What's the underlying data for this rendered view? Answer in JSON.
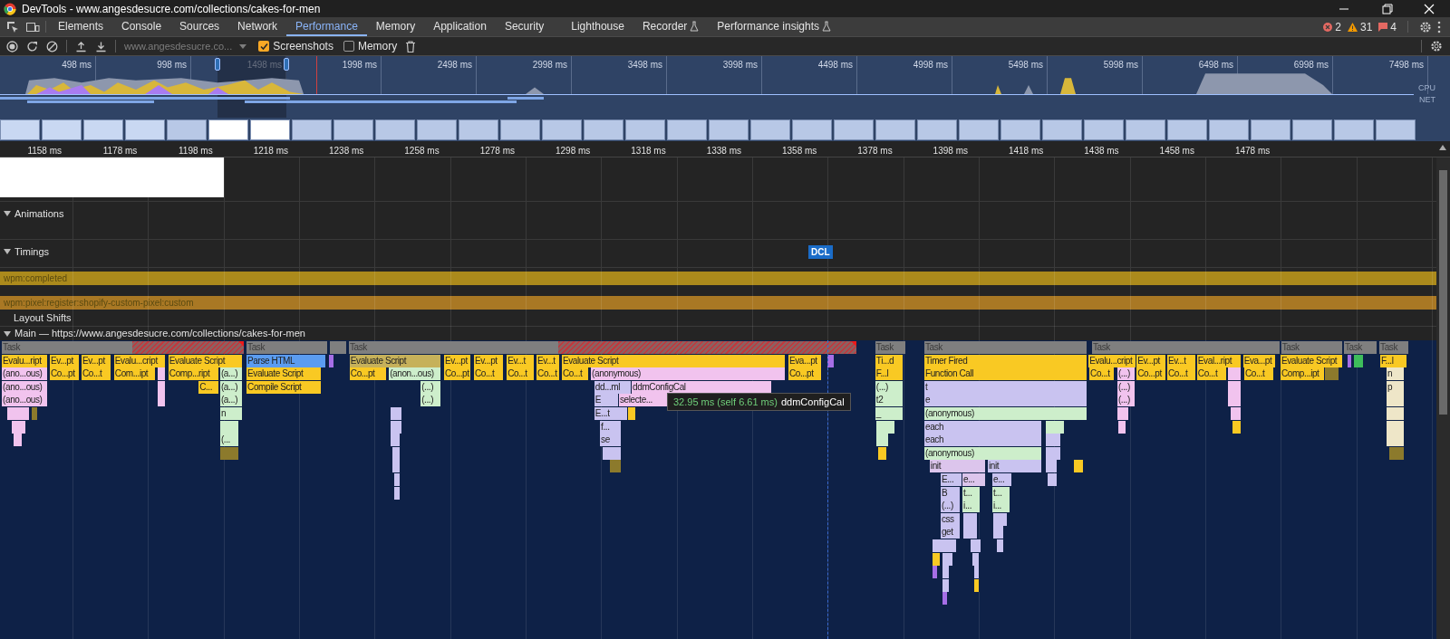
{
  "window": {
    "title": "DevTools - www.angesdesucre.com/collections/cakes-for-men"
  },
  "tabs": [
    {
      "label": "Elements",
      "selected": false,
      "experimental": false
    },
    {
      "label": "Console",
      "selected": false,
      "experimental": false
    },
    {
      "label": "Sources",
      "selected": false,
      "experimental": false
    },
    {
      "label": "Network",
      "selected": false,
      "experimental": false
    },
    {
      "label": "Performance",
      "selected": true,
      "experimental": false
    },
    {
      "label": "Memory",
      "selected": false,
      "experimental": false
    },
    {
      "label": "Application",
      "selected": false,
      "experimental": false
    },
    {
      "label": "Security",
      "selected": false,
      "experimental": false
    },
    {
      "label": "Lighthouse",
      "selected": false,
      "experimental": false
    },
    {
      "label": "Recorder",
      "selected": false,
      "experimental": true
    },
    {
      "label": "Performance insights",
      "selected": false,
      "experimental": true
    }
  ],
  "issues": {
    "errors": "2",
    "warnings": "31",
    "messages": "4"
  },
  "toolbar": {
    "recording_select": "www.angesdesucre.co...",
    "options": [
      {
        "label": "Screenshots",
        "checked": true
      },
      {
        "label": "Memory",
        "checked": false
      }
    ]
  },
  "overview": {
    "time_labels": [
      "498 ms",
      "998 ms",
      "1498 ms",
      "1998 ms",
      "2498 ms",
      "2998 ms",
      "3498 ms",
      "3998 ms",
      "4498 ms",
      "4998 ms",
      "5498 ms",
      "5998 ms",
      "6498 ms",
      "6998 ms",
      "7498 ms"
    ],
    "lane_labels": [
      "CPU",
      "NET"
    ]
  },
  "ruler": [
    "1158 ms",
    "1178 ms",
    "1198 ms",
    "1218 ms",
    "1238 ms",
    "1258 ms",
    "1278 ms",
    "1298 ms",
    "1318 ms",
    "1338 ms",
    "1358 ms",
    "1378 ms",
    "1398 ms",
    "1418 ms",
    "1438 ms",
    "1458 ms",
    "1478 ms"
  ],
  "sections": [
    {
      "label": "Animations",
      "expanded": true
    },
    {
      "label": "Timings",
      "expanded": true
    }
  ],
  "dcl_marker": "DCL",
  "user_timings": [
    {
      "label": "wpm:completed",
      "color": "#ab8a1c"
    },
    {
      "label": "wpm:pixel:register:shopify-custom-pixel:custom",
      "color": "#a97824"
    }
  ],
  "layout_shifts": "Layout Shifts",
  "main": {
    "title": "Main — https://www.angesdesucre.com/collections/cakes-for-men",
    "expanded": true,
    "rows": [
      {
        "entries": [
          {
            "label": "Task",
            "color": "#7f7f7f",
            "long_task": true
          },
          {
            "label": "Task",
            "color": "#7f7f7f",
            "long_task": false
          },
          {
            "color": "#7f7f7f",
            "long_task": false
          },
          {
            "label": "Task",
            "color": "#7f7f7f",
            "long_task": true
          },
          {
            "label": "Task",
            "color": "#7f7f7f",
            "long_task": false
          },
          {
            "label": "Task",
            "color": "#7f7f7f",
            "long_task": false
          },
          {
            "label": "Task",
            "color": "#7f7f7f",
            "long_task": false
          },
          {
            "label": "Task",
            "color": "#7f7f7f",
            "long_task": false
          },
          {
            "label": "Task",
            "color": "#7f7f7f",
            "long_task": false
          },
          {
            "label": "Task",
            "color": "#7f7f7f",
            "long_task": false
          }
        ]
      },
      {
        "entries": [
          {
            "label": "Evalu...ript",
            "color": "#f9c923"
          },
          {
            "label": "Ev...pt",
            "color": "#f9c923"
          },
          {
            "label": "Ev...pt",
            "color": "#f9c923"
          },
          {
            "label": "Evalu...cript",
            "color": "#f9c923"
          },
          {
            "label": "Evaluate Script",
            "color": "#f9c923"
          },
          {
            "label": "Parse HTML",
            "color": "#5b9cf0"
          },
          {
            "color": "#a66ee6"
          },
          {
            "label": "Evaluate Script",
            "color": "#c6b15a"
          },
          {
            "label": "Ev...pt",
            "color": "#f9c923"
          },
          {
            "label": "Ev...pt",
            "color": "#f9c923"
          },
          {
            "label": "Ev...t",
            "color": "#f9c923"
          },
          {
            "label": "Ev...t",
            "color": "#f9c923"
          },
          {
            "label": "Evaluate Script",
            "color": "#f9c923"
          },
          {
            "label": "Eva...pt",
            "color": "#f9c923"
          },
          {
            "color": "#a66ee6"
          },
          {
            "label": "Ti...d",
            "color": "#f9c923"
          },
          {
            "label": "Timer Fired",
            "color": "#f9c923"
          },
          {
            "label": "Evalu...cript",
            "color": "#f9c923"
          },
          {
            "label": "Ev...pt",
            "color": "#f9c923"
          },
          {
            "label": "Ev...t",
            "color": "#f9c923"
          },
          {
            "label": "Eval...ript",
            "color": "#f9c923"
          },
          {
            "label": "Eva...pt",
            "color": "#f9c923"
          },
          {
            "label": "Evaluate Script",
            "color": "#f9c923"
          },
          {
            "color": "#a66ee6"
          },
          {
            "color": "#3ebd5b"
          },
          {
            "label": "F...l",
            "color": "#f9c923"
          }
        ]
      },
      {
        "entries": [
          {
            "label": "(ano...ous)",
            "color": "#f1c3ee"
          },
          {
            "label": "Co...pt",
            "color": "#f9c923"
          },
          {
            "label": "Co...t",
            "color": "#f9c923"
          },
          {
            "label": "Com...ipt",
            "color": "#f9c923"
          },
          {
            "color": "#f1c3ee"
          },
          {
            "label": "Comp...ript",
            "color": "#f9c923"
          },
          {
            "label": "(a...)",
            "color": "#cdeecb"
          },
          {
            "label": "Evaluate Script",
            "color": "#f9c923"
          },
          {
            "label": "Co...pt",
            "color": "#f9c923"
          },
          {
            "label": "(anon...ous)",
            "color": "#cdeecb"
          },
          {
            "label": "Co...pt",
            "color": "#f9c923"
          },
          {
            "label": "Co...t",
            "color": "#f9c923"
          },
          {
            "label": "Co...t",
            "color": "#f9c923"
          },
          {
            "label": "Co...t",
            "color": "#f9c923"
          },
          {
            "label": "Co...t",
            "color": "#f9c923"
          },
          {
            "label": "(anonymous)",
            "color": "#f1c3ee"
          },
          {
            "label": "Co...pt",
            "color": "#f9c923"
          },
          {
            "label": "F...l",
            "color": "#f9c923"
          },
          {
            "label": "Function Call",
            "color": "#f9c923"
          },
          {
            "label": "Co...t",
            "color": "#f9c923"
          },
          {
            "label": "(...)",
            "color": "#f1c3ee"
          },
          {
            "label": "Co...pt",
            "color": "#f9c923"
          },
          {
            "label": "Co...t",
            "color": "#f9c923"
          },
          {
            "label": "Co...t",
            "color": "#f9c923"
          },
          {
            "color": "#f1c3ee"
          },
          {
            "label": "Co...t",
            "color": "#f9c923"
          },
          {
            "label": "Comp...ipt",
            "color": "#f9c923"
          },
          {
            "color": "#8c7a2c"
          },
          {
            "label": "n",
            "color": "#eee6c8"
          }
        ]
      },
      {
        "entries": [
          {
            "label": "(ano...ous)",
            "color": "#f1c3ee"
          },
          {
            "color": "#f1c3ee"
          },
          {
            "label": "C...",
            "color": "#f9c923"
          },
          {
            "label": "(a...)",
            "color": "#cdeecb"
          },
          {
            "label": "Compile Script",
            "color": "#f9c923"
          },
          {
            "label": "(...)",
            "color": "#cdeecb"
          },
          {
            "label": "dd...ml",
            "color": "#c9c3f0"
          },
          {
            "label": "ddmConfigCal",
            "color": "#f1c3ee"
          },
          {
            "label": "(...)",
            "color": "#cdeecb"
          },
          {
            "label": "t",
            "color": "#c9c3f0"
          },
          {
            "label": "(...)",
            "color": "#f1c3ee"
          },
          {
            "color": "#f1c3ee"
          },
          {
            "label": "p",
            "color": "#eee6c8"
          }
        ]
      },
      {
        "entries": [
          {
            "label": "(ano...ous)",
            "color": "#f1c3ee"
          },
          {
            "color": "#f1c3ee"
          },
          {
            "label": "(a...)",
            "color": "#cdeecb"
          },
          {
            "label": "(...)",
            "color": "#cdeecb"
          },
          {
            "label": "E",
            "color": "#c9c3f0"
          },
          {
            "label": "selecte...",
            "color": "#f1c3ee"
          },
          {
            "label": "t2",
            "color": "#cdeecb"
          },
          {
            "label": "e",
            "color": "#c9c3f0"
          },
          {
            "label": "(...)",
            "color": "#f1c3ee"
          },
          {
            "color": "#f1c3ee"
          },
          {
            "color": "#eee6c8"
          }
        ]
      },
      {
        "entries": [
          {
            "color": "#f1c3ee"
          },
          {
            "color": "#8c7a2c"
          },
          {
            "label": "n",
            "color": "#cdeecb"
          },
          {
            "color": "#c9c3f0"
          },
          {
            "label": "E...t",
            "color": "#c9c3f0"
          },
          {
            "color": "#f9c923"
          },
          {
            "label": "_",
            "color": "#cdeecb"
          },
          {
            "label": "(anonymous)",
            "color": "#cdeecb"
          },
          {
            "color": "#f1c3ee"
          },
          {
            "color": "#f1c3ee"
          },
          {
            "color": "#eee6c8"
          }
        ]
      },
      {
        "entries": [
          {
            "color": "#f1c3ee"
          },
          {
            "color": "#cdeecb"
          },
          {
            "color": "#c9c3f0"
          },
          {
            "label": "f...",
            "color": "#c9c3f0"
          },
          {
            "color": "#cdeecb"
          },
          {
            "label": "each",
            "color": "#c9c3f0"
          },
          {
            "color": "#cdeecb"
          },
          {
            "color": "#f1c3ee"
          },
          {
            "color": "#f9c923"
          },
          {
            "color": "#eee6c8"
          }
        ]
      },
      {
        "entries": [
          {
            "color": "#f1c3ee"
          },
          {
            "label": "(...",
            "color": "#cdeecb"
          },
          {
            "color": "#c9c3f0"
          },
          {
            "label": "se",
            "color": "#c9c3f0"
          },
          {
            "color": "#cdeecb"
          },
          {
            "label": "each",
            "color": "#c9c3f0"
          },
          {
            "color": "#c9c3f0"
          },
          {
            "color": "#eee6c8"
          }
        ]
      },
      {
        "entries": [
          {
            "color": "#8c7a2c"
          },
          {
            "color": "#c9c3f0"
          },
          {
            "color": "#c9c3f0"
          },
          {
            "color": "#f9c923"
          },
          {
            "label": "(anonymous)",
            "color": "#cdeecb"
          },
          {
            "color": "#c9c3f0"
          },
          {
            "color": "#8c7a2c"
          }
        ]
      },
      {
        "entries": [
          {
            "color": "#c9c3f0"
          },
          {
            "color": "#8c7a2c"
          },
          {
            "label": "init",
            "color": "#dcc5ec"
          },
          {
            "label": "init",
            "color": "#c9c3f0"
          },
          {
            "color": "#c9c3f0"
          },
          {
            "color": "#f9c923"
          }
        ]
      },
      {
        "entries": [
          {
            "color": "#c9c3f0"
          },
          {
            "label": "E...",
            "color": "#c9c3f0"
          },
          {
            "label": "e...",
            "color": "#dcc5ec"
          },
          {
            "label": "e...",
            "color": "#c9c3f0"
          },
          {
            "color": "#c9c3f0"
          }
        ]
      },
      {
        "entries": [
          {
            "color": "#c9c3f0"
          },
          {
            "label": "B",
            "color": "#c9c3f0"
          },
          {
            "label": "t...",
            "color": "#cdeecb"
          },
          {
            "label": "t...",
            "color": "#cdeecb"
          }
        ]
      },
      {
        "entries": [
          {
            "label": "(...)",
            "color": "#c9c3f0"
          },
          {
            "label": "i...",
            "color": "#cdeecb"
          },
          {
            "label": "i...",
            "color": "#cdeecb"
          }
        ]
      },
      {
        "entries": [
          {
            "label": "css",
            "color": "#c9c3f0"
          },
          {
            "color": "#c9c3f0"
          },
          {
            "color": "#c9c3f0"
          }
        ]
      },
      {
        "entries": [
          {
            "label": "get",
            "color": "#c9c3f0"
          },
          {
            "color": "#c9c3f0"
          },
          {
            "color": "#c9c3f0"
          }
        ]
      },
      {
        "entries": [
          {
            "color": "#c9c3f0"
          },
          {
            "color": "#c9c3f0"
          },
          {
            "color": "#c9c3f0"
          }
        ]
      },
      {
        "entries": [
          {
            "color": "#f9c923"
          },
          {
            "color": "#c9c3f0"
          },
          {
            "color": "#c9c3f0"
          }
        ]
      },
      {
        "entries": [
          {
            "color": "#a66ee6"
          },
          {
            "color": "#c9c3f0"
          },
          {
            "color": "#c9c3f0"
          }
        ]
      },
      {
        "entries": [
          {
            "color": "#c9c3f0"
          },
          {
            "color": "#f9c923"
          }
        ]
      },
      {
        "entries": [
          {
            "color": "#a66ee6"
          }
        ]
      }
    ]
  },
  "tooltip": {
    "duration": "32.95 ms (self 6.61 ms)",
    "name": "ddmConfigCal"
  }
}
